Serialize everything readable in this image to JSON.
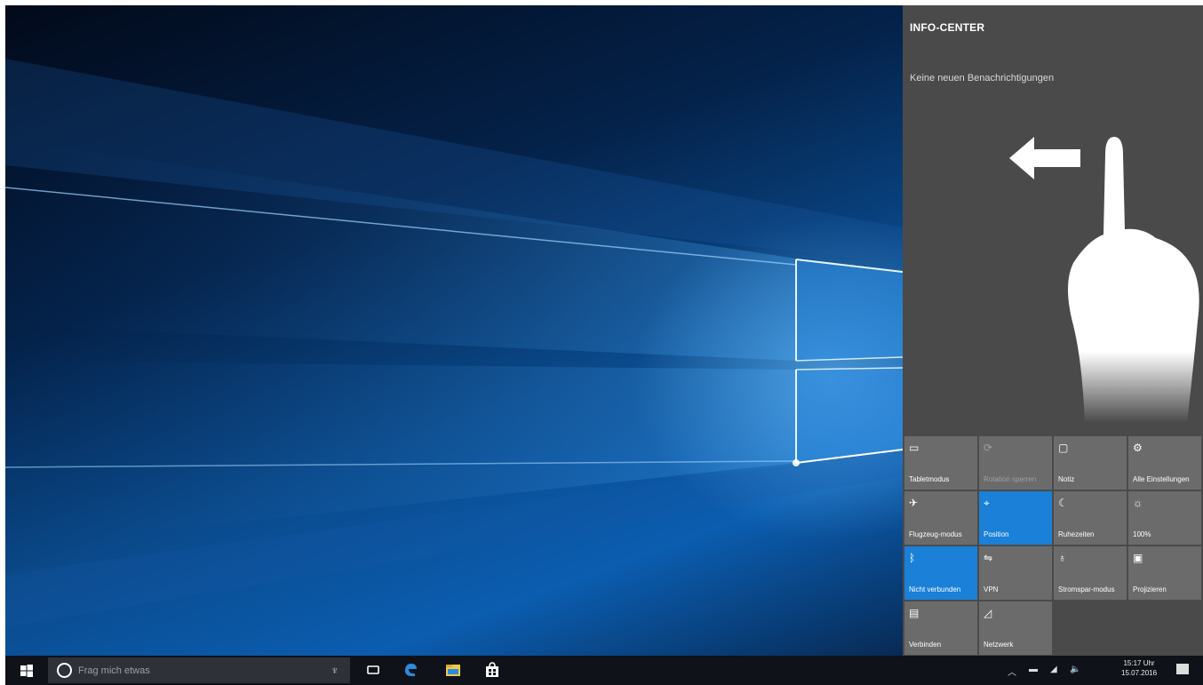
{
  "action_center": {
    "title": "INFO-CENTER",
    "no_notifications": "Keine neuen Benachrichtigungen",
    "tiles": [
      {
        "label": "Tabletmodus",
        "icon": "tablet-icon",
        "state": "normal"
      },
      {
        "label": "Rotation sperren",
        "icon": "rotation-lock-icon",
        "state": "disabled"
      },
      {
        "label": "Notiz",
        "icon": "note-icon",
        "state": "normal"
      },
      {
        "label": "Alle Einstellungen",
        "icon": "settings-icon",
        "state": "normal"
      },
      {
        "label": "Flugzeug-modus",
        "icon": "airplane-icon",
        "state": "normal"
      },
      {
        "label": "Position",
        "icon": "location-icon",
        "state": "active"
      },
      {
        "label": "Ruhezeiten",
        "icon": "moon-icon",
        "state": "normal"
      },
      {
        "label": "100%",
        "icon": "brightness-icon",
        "state": "normal"
      },
      {
        "label": "Nicht verbunden",
        "icon": "bluetooth-icon",
        "state": "active"
      },
      {
        "label": "VPN",
        "icon": "vpn-icon",
        "state": "normal"
      },
      {
        "label": "Stromspar-modus",
        "icon": "battery-saver-icon",
        "state": "normal"
      },
      {
        "label": "Projizieren",
        "icon": "project-icon",
        "state": "normal"
      },
      {
        "label": "Verbinden",
        "icon": "connect-icon",
        "state": "normal"
      },
      {
        "label": "Netzwerk",
        "icon": "network-icon",
        "state": "normal"
      }
    ]
  },
  "taskbar": {
    "search_placeholder": "Frag mich etwas",
    "pinned": [
      {
        "name": "task-view-icon"
      },
      {
        "name": "edge-icon"
      },
      {
        "name": "file-explorer-icon"
      },
      {
        "name": "store-icon"
      }
    ],
    "clock_time": "15:17 Uhr",
    "clock_date": "15.07.2016"
  },
  "colors": {
    "accent": "#1a80d8",
    "tile": "#6b6b6b",
    "panel": "#4a4a4a",
    "taskbar": "#0f1218"
  }
}
